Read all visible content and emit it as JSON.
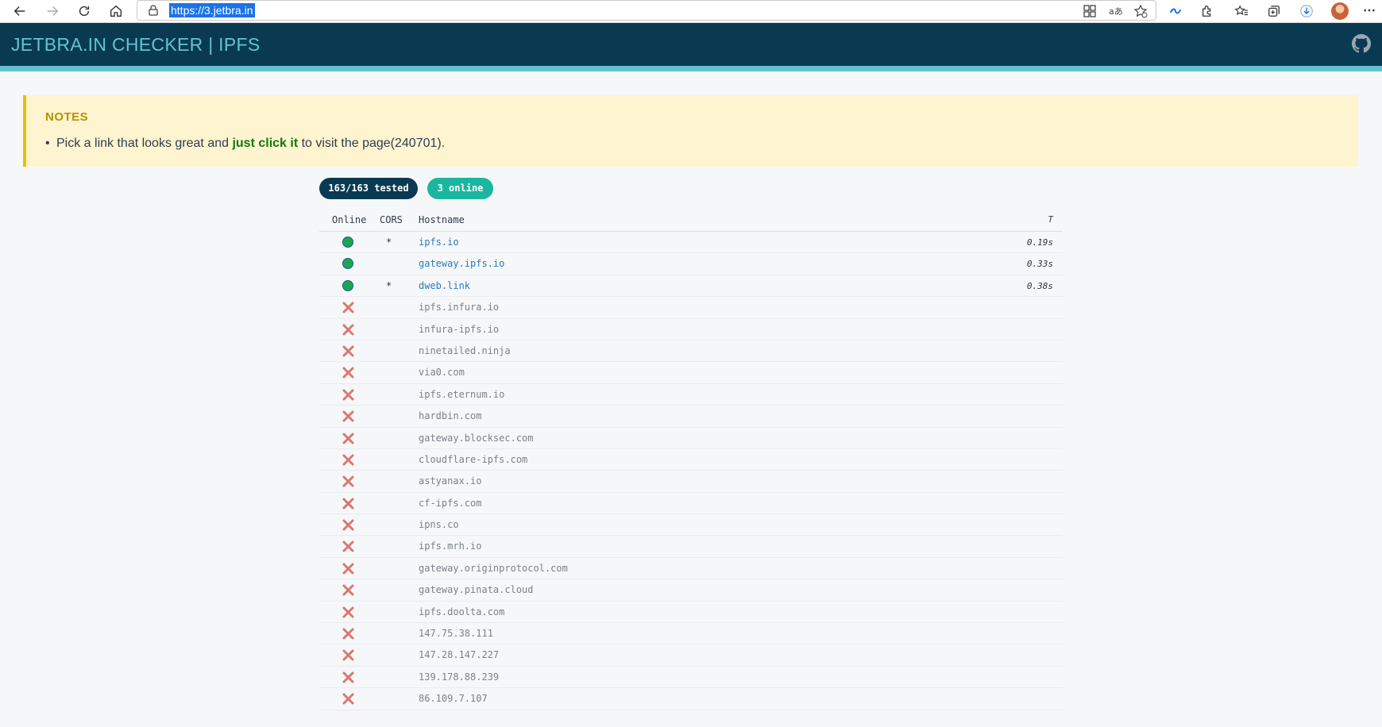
{
  "browser": {
    "url": "https://3.jetbra.in"
  },
  "header": {
    "title": "JETBRA.IN CHECKER | IPFS"
  },
  "notes": {
    "title": "NOTES",
    "text_before": "Pick a link that looks great and ",
    "highlight": "just click it",
    "text_after": " to visit the page(240701)."
  },
  "badges": {
    "tested": "163/163 tested",
    "online": "3 online"
  },
  "table": {
    "columns": [
      "Online",
      "CORS",
      "Hostname",
      "T"
    ],
    "rows": [
      {
        "online": true,
        "cors": "*",
        "host": "ipfs.io",
        "time": "0.19s"
      },
      {
        "online": true,
        "cors": "",
        "host": "gateway.ipfs.io",
        "time": "0.33s"
      },
      {
        "online": true,
        "cors": "*",
        "host": "dweb.link",
        "time": "0.38s"
      },
      {
        "online": false,
        "cors": "",
        "host": "ipfs.infura.io",
        "time": ""
      },
      {
        "online": false,
        "cors": "",
        "host": "infura-ipfs.io",
        "time": ""
      },
      {
        "online": false,
        "cors": "",
        "host": "ninetailed.ninja",
        "time": ""
      },
      {
        "online": false,
        "cors": "",
        "host": "via0.com",
        "time": ""
      },
      {
        "online": false,
        "cors": "",
        "host": "ipfs.eternum.io",
        "time": ""
      },
      {
        "online": false,
        "cors": "",
        "host": "hardbin.com",
        "time": ""
      },
      {
        "online": false,
        "cors": "",
        "host": "gateway.blocksec.com",
        "time": ""
      },
      {
        "online": false,
        "cors": "",
        "host": "cloudflare-ipfs.com",
        "time": ""
      },
      {
        "online": false,
        "cors": "",
        "host": "astyanax.io",
        "time": ""
      },
      {
        "online": false,
        "cors": "",
        "host": "cf-ipfs.com",
        "time": ""
      },
      {
        "online": false,
        "cors": "",
        "host": "ipns.co",
        "time": ""
      },
      {
        "online": false,
        "cors": "",
        "host": "ipfs.mrh.io",
        "time": ""
      },
      {
        "online": false,
        "cors": "",
        "host": "gateway.originprotocol.com",
        "time": ""
      },
      {
        "online": false,
        "cors": "",
        "host": "gateway.pinata.cloud",
        "time": ""
      },
      {
        "online": false,
        "cors": "",
        "host": "ipfs.doolta.com",
        "time": ""
      },
      {
        "online": false,
        "cors": "",
        "host": "147.75.38.111",
        "time": ""
      },
      {
        "online": false,
        "cors": "",
        "host": "147.28.147.227",
        "time": ""
      },
      {
        "online": false,
        "cors": "",
        "host": "139.178.88.239",
        "time": ""
      },
      {
        "online": false,
        "cors": "",
        "host": "86.109.7.107",
        "time": ""
      }
    ]
  },
  "icons": {
    "online": "online-dot-icon",
    "offline": "offline-x-icon"
  },
  "colors": {
    "header_bg": "#0a3a52",
    "header_accent": "#62c3d0",
    "notes_bg": "#fff4d0",
    "notes_border": "#e7c000",
    "online_badge": "#1ab79e",
    "offline_x": "#d9776f",
    "link": "#2b7bc0"
  }
}
